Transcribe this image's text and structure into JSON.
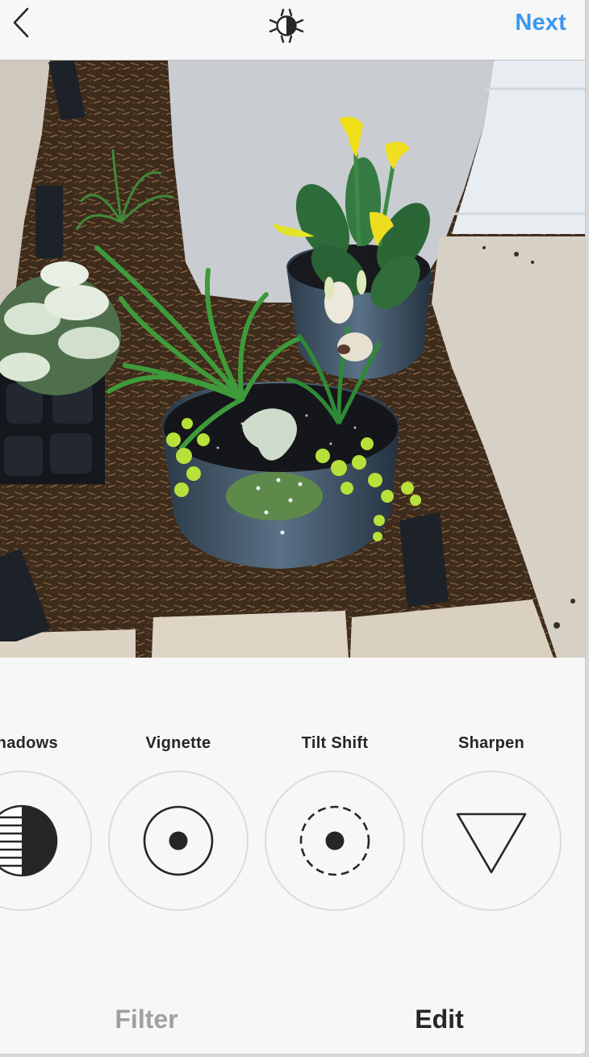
{
  "header": {
    "back_icon": "chevron-left-icon",
    "center_icon": "lux-brightness-icon",
    "next_label": "Next",
    "accent_color": "#3897f0"
  },
  "photo": {
    "description": "Garden bed with potted plants: yellow calla lilies, spider plant, white lilies, creeping jenny and polka-dot plant in blue ceramic pots beside a stucco column, mulch, solar lights and paver stones"
  },
  "tools": [
    {
      "label": "Shadows",
      "icon": "shadows-icon"
    },
    {
      "label": "Vignette",
      "icon": "vignette-icon"
    },
    {
      "label": "Tilt Shift",
      "icon": "tilt-shift-icon"
    },
    {
      "label": "Sharpen",
      "icon": "sharpen-icon"
    }
  ],
  "tabs": [
    {
      "label": "Filter",
      "active": false
    },
    {
      "label": "Edit",
      "active": true
    }
  ]
}
